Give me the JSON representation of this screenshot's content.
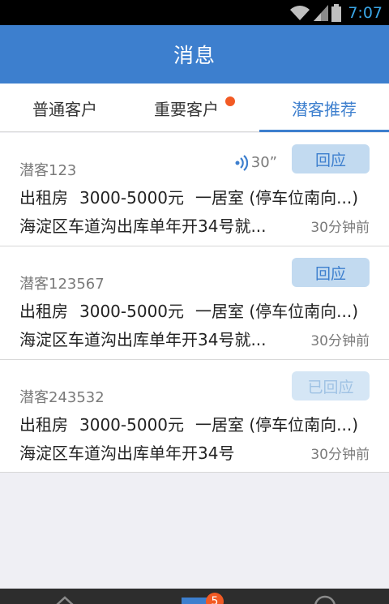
{
  "status_bar": {
    "time": "7:07"
  },
  "header": {
    "title": "消息"
  },
  "tabs": [
    {
      "label": "普通客户"
    },
    {
      "label": "重要客户",
      "has_dot": true
    },
    {
      "label": "潜客推荐",
      "active": true
    }
  ],
  "items": [
    {
      "name": "潜客123",
      "voice_length": "30”",
      "button": "回应",
      "type": "出租房",
      "price": "3000-5000元",
      "layout": "一居室 (停车位南向...)",
      "address": "海淀区车道沟出库单年开34号就...",
      "time": "30分钟前"
    },
    {
      "name": "潜客123567",
      "button": "回应",
      "type": "出租房",
      "price": "3000-5000元",
      "layout": "一居室 (停车位南向...)",
      "address": "海淀区车道沟出库单年开34号就...",
      "time": "30分钟前"
    },
    {
      "name": "潜客243532",
      "button": "已回应",
      "type": "出租房",
      "price": "3000-5000元",
      "layout": "一居室 (停车位南向...)",
      "address": "海淀区车道沟出库单年开34号",
      "time": "30分钟前"
    }
  ],
  "bottom_nav": {
    "badge": "5"
  },
  "colors": {
    "accent": "#3d7fce",
    "badge": "#f25a24",
    "button_bg": "#c2daf0"
  }
}
